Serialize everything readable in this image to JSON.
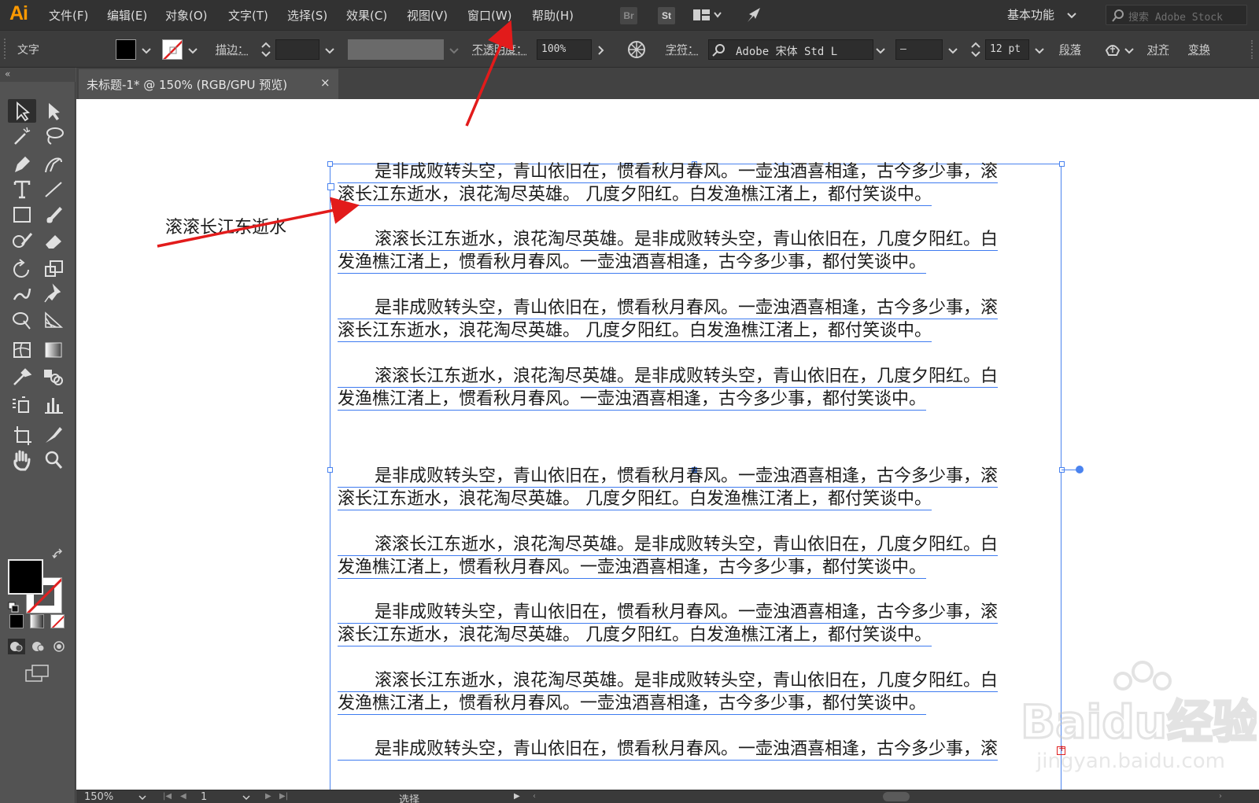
{
  "app": {
    "logo": "Ai"
  },
  "menu": [
    "文件(F)",
    "编辑(E)",
    "对象(O)",
    "文字(T)",
    "选择(S)",
    "效果(C)",
    "视图(V)",
    "窗口(W)",
    "帮助(H)"
  ],
  "bridge_badges": {
    "br": "Br",
    "st": "St"
  },
  "workspace": "基本功能",
  "stock_search": {
    "placeholder": "搜索 Adobe Stock"
  },
  "control": {
    "selection_type": "文字",
    "stroke_label": "描边：",
    "opacity_label": "不透明度：",
    "opacity_value": "100%",
    "char_label": "字符：",
    "font_name": "Adobe 宋体 Std L",
    "font_style": "–",
    "font_size": "12 pt",
    "paragraph": "段落",
    "align": "对齐",
    "transform": "变换"
  },
  "tab": {
    "title": "未标题-1* @ 150% (RGB/GPU 预览)",
    "close": "×"
  },
  "canvas": {
    "note": "滚滚长江东逝水",
    "paragraphs": [
      [
        "是非成败转头空，青山依旧在，惯看秋月春风。一壶浊酒喜相逢，古今多少事，滚",
        "滚长江东逝水，浪花淘尽英雄。 几度夕阳红。白发渔樵江渚上，都付笑谈中。"
      ],
      [
        "滚滚长江东逝水，浪花淘尽英雄。是非成败转头空，青山依旧在，几度夕阳红。白",
        "发渔樵江渚上，惯看秋月春风。一壶浊酒喜相逢，古今多少事，都付笑谈中。"
      ],
      [
        "是非成败转头空，青山依旧在，惯看秋月春风。一壶浊酒喜相逢，古今多少事，滚",
        "滚长江东逝水，浪花淘尽英雄。 几度夕阳红。白发渔樵江渚上，都付笑谈中。"
      ],
      [
        "滚滚长江东逝水，浪花淘尽英雄。是非成败转头空，青山依旧在，几度夕阳红。白",
        "发渔樵江渚上，惯看秋月春风。一壶浊酒喜相逢，古今多少事，都付笑谈中。"
      ],
      [
        "是非成败转头空，青山依旧在，惯看秋月春风。一壶浊酒喜相逢，古今多少事，滚",
        "滚长江东逝水，浪花淘尽英雄。 几度夕阳红。白发渔樵江渚上，都付笑谈中。"
      ],
      [
        "滚滚长江东逝水，浪花淘尽英雄。是非成败转头空，青山依旧在，几度夕阳红。白",
        "发渔樵江渚上，惯看秋月春风。一壶浊酒喜相逢，古今多少事，都付笑谈中。"
      ],
      [
        "是非成败转头空，青山依旧在，惯看秋月春风。一壶浊酒喜相逢，古今多少事，滚",
        "滚长江东逝水，浪花淘尽英雄。 几度夕阳红。白发渔樵江渚上，都付笑谈中。"
      ],
      [
        "滚滚长江东逝水，浪花淘尽英雄。是非成败转头空，青山依旧在，几度夕阳红。白",
        "发渔樵江渚上，惯看秋月春风。一壶浊酒喜相逢，古今多少事，都付笑谈中。"
      ],
      [
        "是非成败转头空，青山依旧在，惯看秋月春风。一壶浊酒喜相逢，古今多少事，滚"
      ]
    ]
  },
  "watermark": {
    "text": "Baidu经验",
    "url": "jingyan.baidu.com"
  },
  "status": {
    "zoom": "150%",
    "page": "1",
    "tool": "选择"
  },
  "colors": {
    "accent": "#4a83ef",
    "arrow": "#e21b1b",
    "logo": "#ff9a00"
  }
}
